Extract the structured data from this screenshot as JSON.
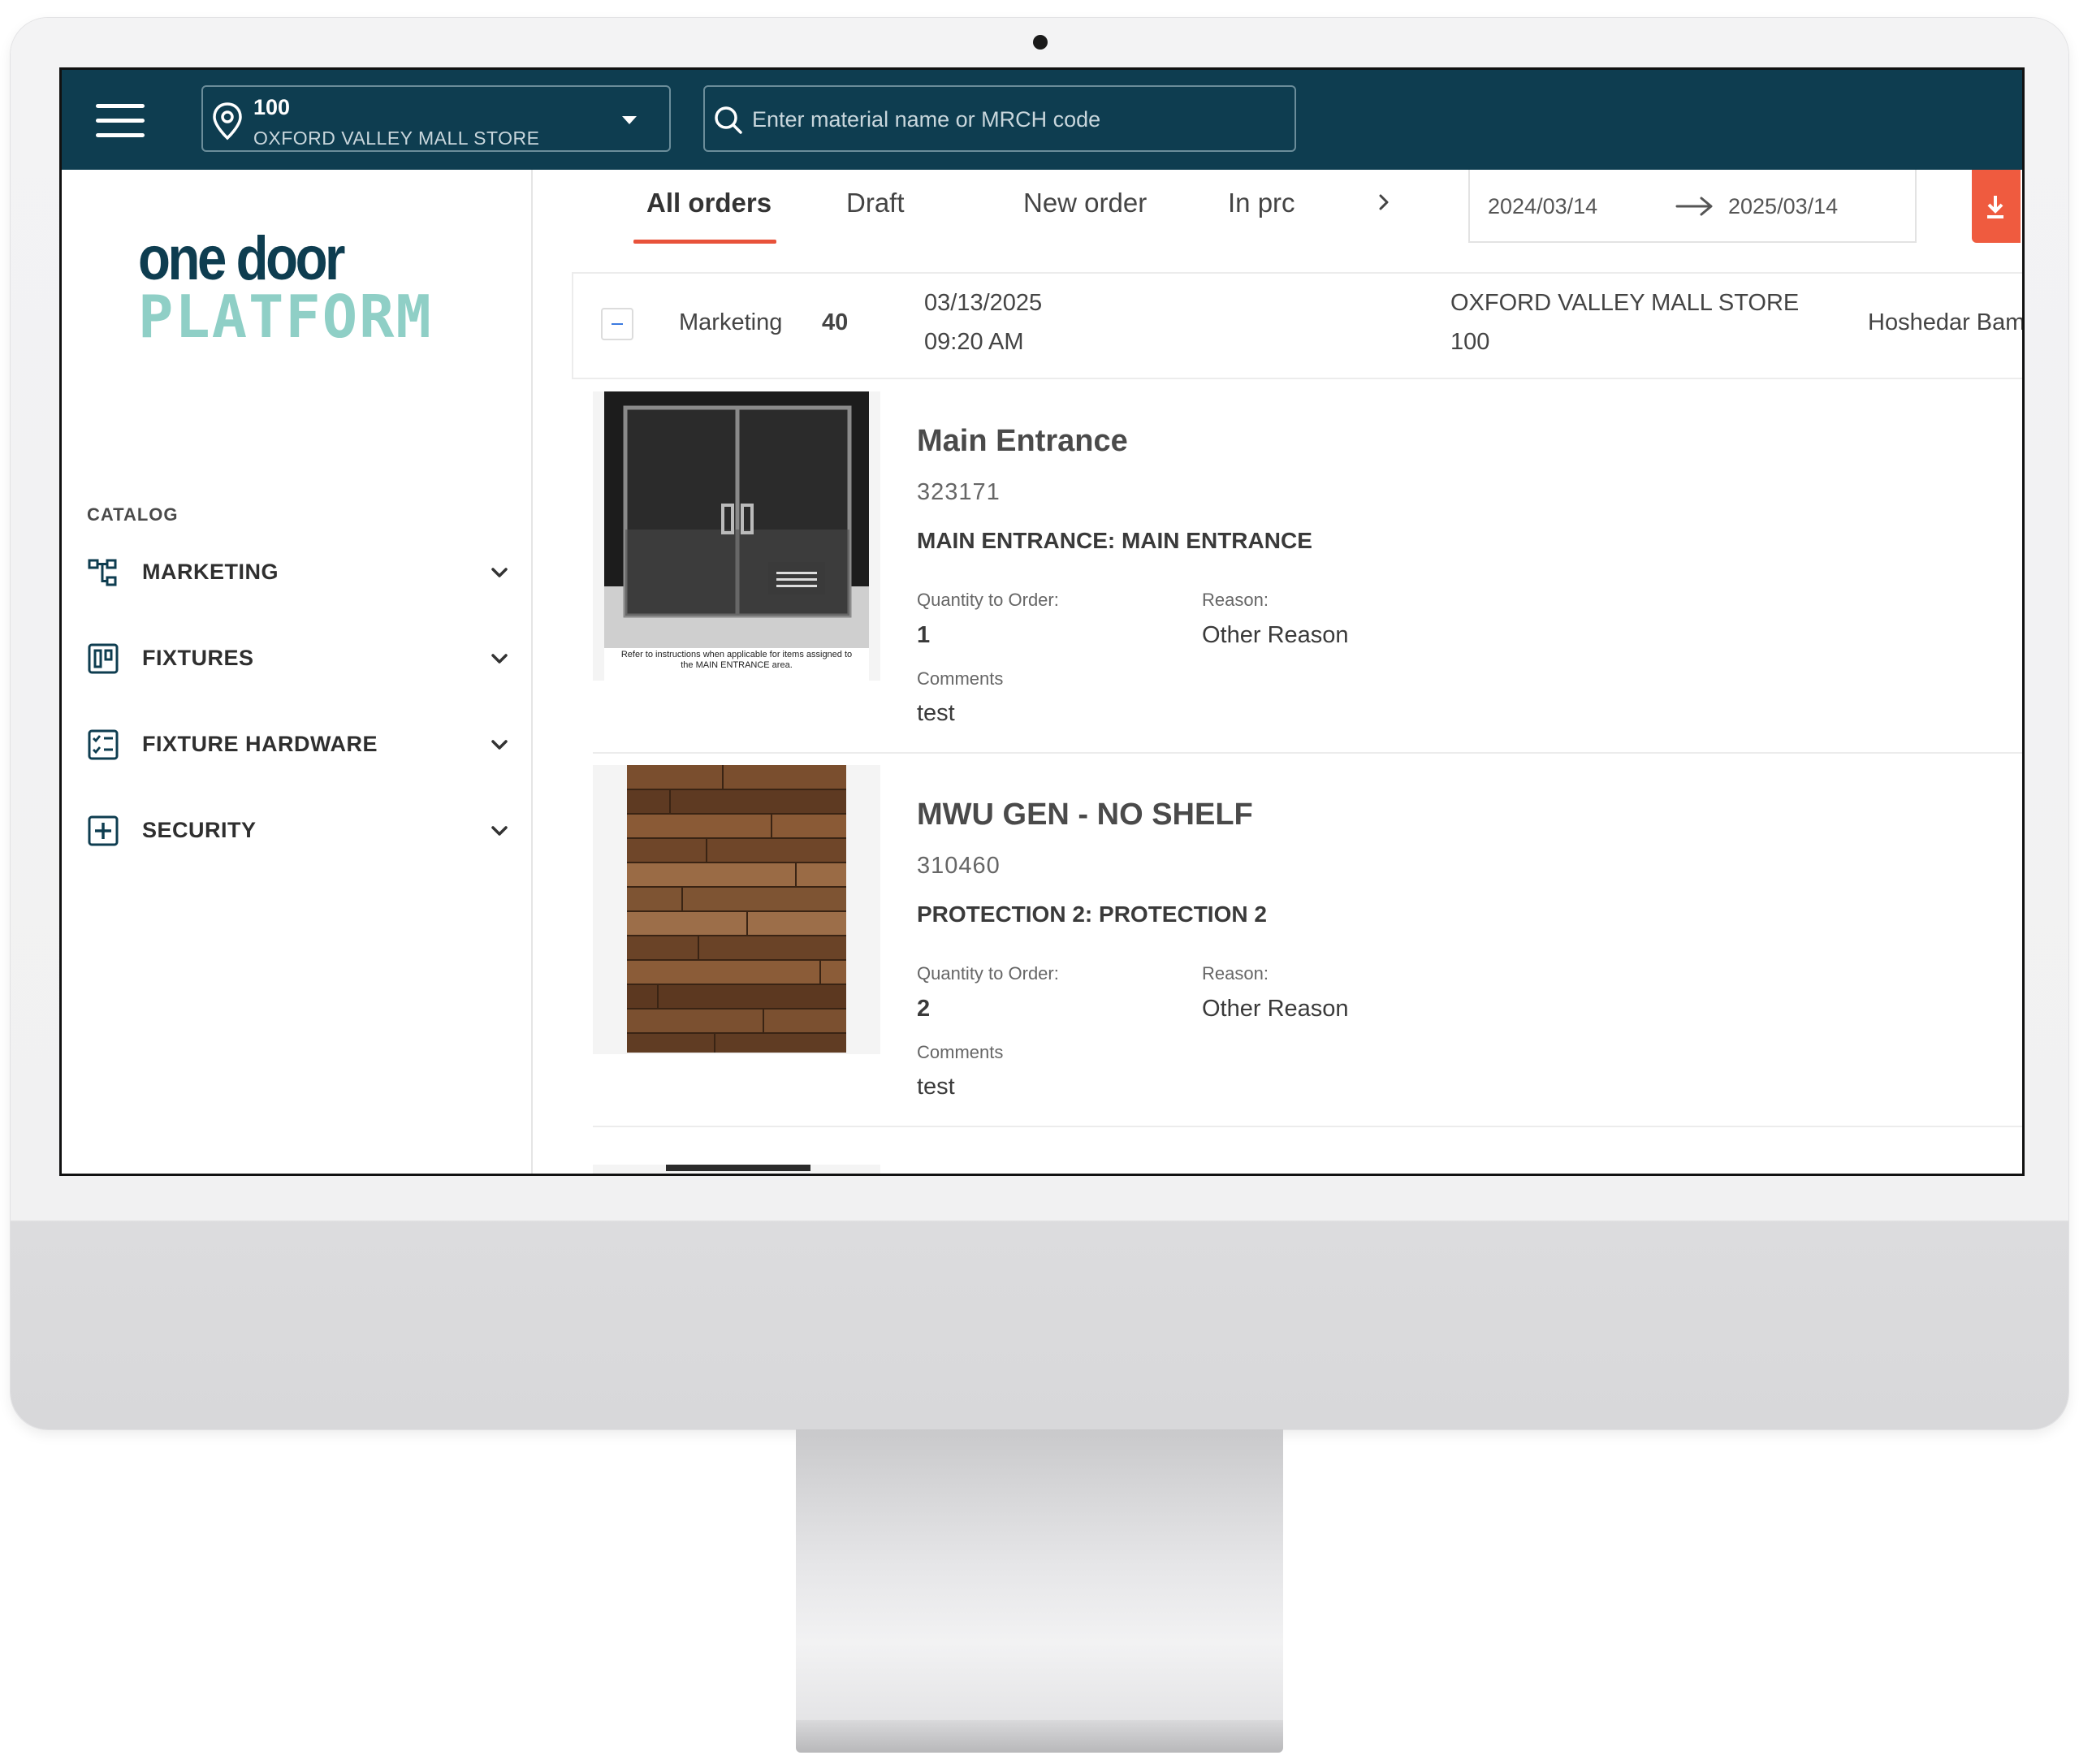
{
  "header": {
    "store_number": "100",
    "store_name": "OXFORD VALLEY MALL STORE",
    "search_placeholder": "Enter material name or MRCH code"
  },
  "logo": {
    "line1": "one door",
    "line2": "PLATFORM"
  },
  "sidebar": {
    "section_label": "CATALOG",
    "items": [
      {
        "label": "MARKETING",
        "icon": "hierarchy-icon"
      },
      {
        "label": "FIXTURES",
        "icon": "fixture-icon"
      },
      {
        "label": "FIXTURE HARDWARE",
        "icon": "checklist-icon"
      },
      {
        "label": "SECURITY",
        "icon": "plus-box-icon"
      }
    ]
  },
  "tabs": [
    {
      "label": "All orders",
      "active": true
    },
    {
      "label": "Draft",
      "active": false
    },
    {
      "label": "New order",
      "active": false
    },
    {
      "label": "In prc",
      "active": false
    }
  ],
  "date_range": {
    "from": "2024/03/14",
    "to": "2025/03/14"
  },
  "order": {
    "category": "Marketing",
    "quantity": "40",
    "date": "03/13/2025",
    "time": "09:20 AM",
    "store": "OXFORD VALLEY MALL STORE",
    "store_number": "100",
    "user": "Hoshedar Bamj"
  },
  "items": [
    {
      "title": "Main Entrance",
      "code": "323171",
      "area": "MAIN ENTRANCE: MAIN ENTRANCE",
      "qty_label": "Quantity to Order:",
      "qty": "1",
      "reason_label": "Reason:",
      "reason": "Other Reason",
      "comments_label": "Comments",
      "comments": "test",
      "image_caption": "Refer to instructions when applicable for items assigned to the MAIN ENTRANCE area."
    },
    {
      "title": "MWU GEN - NO SHELF",
      "code": "310460",
      "area": "PROTECTION 2: PROTECTION 2",
      "qty_label": "Quantity to Order:",
      "qty": "2",
      "reason_label": "Reason:",
      "reason": "Other Reason",
      "comments_label": "Comments",
      "comments": "test"
    }
  ],
  "colors": {
    "topbar": "#0e3d50",
    "accent": "#ef5b3f",
    "logo_dark": "#0e3d50",
    "logo_light": "#8fcfc6"
  }
}
